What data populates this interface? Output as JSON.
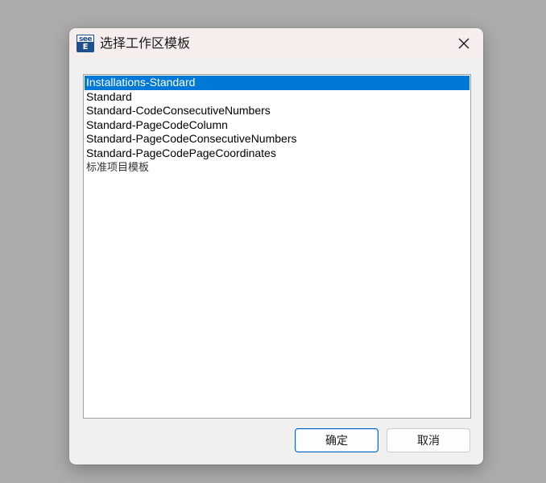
{
  "window": {
    "title": "选择工作区模板",
    "icon": {
      "name": "see-e-app-icon",
      "top_text": "see",
      "bottom_text": "E",
      "color": "#1f4f8f"
    }
  },
  "list": {
    "selected_index": 0,
    "items": [
      {
        "label": "Installations-Standard"
      },
      {
        "label": "Standard"
      },
      {
        "label": "Standard-CodeConsecutiveNumbers"
      },
      {
        "label": "Standard-PageCodeColumn"
      },
      {
        "label": "Standard-PageCodeConsecutiveNumbers"
      },
      {
        "label": "Standard-PageCodePageCoordinates"
      },
      {
        "label": "标准项目模板"
      }
    ],
    "selection_color": "#0078d7"
  },
  "buttons": {
    "ok_label": "确定",
    "cancel_label": "取消"
  }
}
